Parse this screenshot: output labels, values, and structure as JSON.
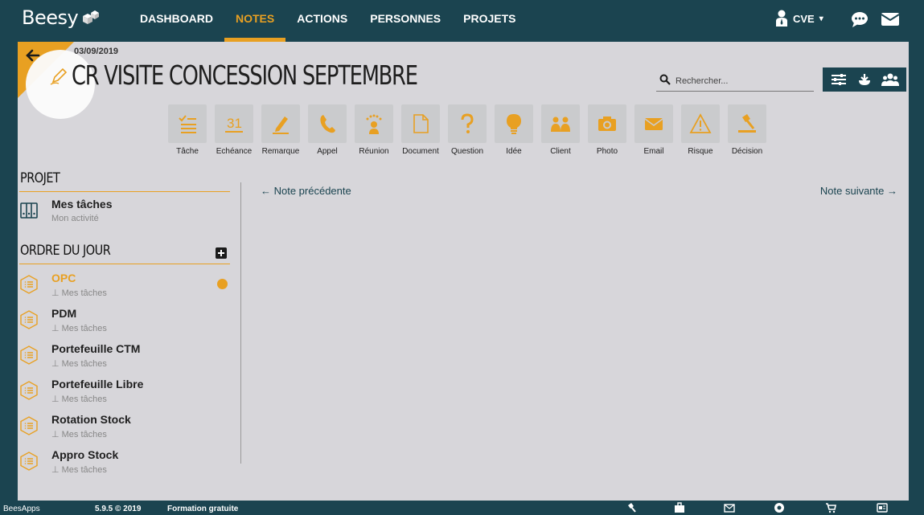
{
  "brand": {
    "name": "Beesy"
  },
  "nav": {
    "items": [
      {
        "label": "DASHBOARD"
      },
      {
        "label": "NOTES"
      },
      {
        "label": "ACTIONS"
      },
      {
        "label": "PERSONNES"
      },
      {
        "label": "PROJETS"
      }
    ],
    "active": "NOTES"
  },
  "user": {
    "initials": "CVE",
    "caret": "▾"
  },
  "note": {
    "date": "03/09/2019",
    "title": "CR VISITE CONCESSION SEPTEMBRE"
  },
  "search": {
    "placeholder": "Rechercher..."
  },
  "toolbar_icons": [
    "sliders-icon",
    "download-icon",
    "people-icon"
  ],
  "actions": [
    {
      "label": "Tâche",
      "icon": "checklist-icon"
    },
    {
      "label": "Echéance",
      "icon": "calendar-31-icon"
    },
    {
      "label": "Remarque",
      "icon": "pencil-icon"
    },
    {
      "label": "Appel",
      "icon": "phone-icon"
    },
    {
      "label": "Réunion",
      "icon": "meeting-icon"
    },
    {
      "label": "Document",
      "icon": "document-icon"
    },
    {
      "label": "Question",
      "icon": "question-icon"
    },
    {
      "label": "Idée",
      "icon": "lightbulb-icon"
    },
    {
      "label": "Client",
      "icon": "client-icon"
    },
    {
      "label": "Photo",
      "icon": "camera-icon"
    },
    {
      "label": "Email",
      "icon": "envelope-icon"
    },
    {
      "label": "Risque",
      "icon": "warning-icon"
    },
    {
      "label": "Décision",
      "icon": "gavel-icon"
    }
  ],
  "sidebar": {
    "projet": {
      "heading": "PROJET",
      "item": {
        "name": "Mes tâches",
        "sub": "Mon activité"
      }
    },
    "agenda": {
      "heading": "ORDRE DU JOUR",
      "items": [
        {
          "name": "OPC",
          "sub": "Mes tâches",
          "active": true
        },
        {
          "name": "PDM",
          "sub": "Mes tâches"
        },
        {
          "name": "Portefeuille CTM",
          "sub": "Mes tâches"
        },
        {
          "name": "Portefeuille Libre",
          "sub": "Mes tâches"
        },
        {
          "name": "Rotation Stock",
          "sub": "Mes tâches"
        },
        {
          "name": "Appro Stock",
          "sub": "Mes tâches"
        }
      ]
    }
  },
  "pager": {
    "prev": "← Note précédente",
    "next": "Note suivante →"
  },
  "footer": {
    "brand": "BeesApps",
    "version": "5.9.5 © 2019",
    "link": "Formation gratuite",
    "icons": [
      "gavel-icon",
      "briefcase-icon",
      "mail-icon",
      "help-icon",
      "cart-icon",
      "id-card-icon"
    ]
  },
  "colors": {
    "accent": "#e8a022",
    "dark": "#1b4450",
    "page": "#d7d6da"
  }
}
